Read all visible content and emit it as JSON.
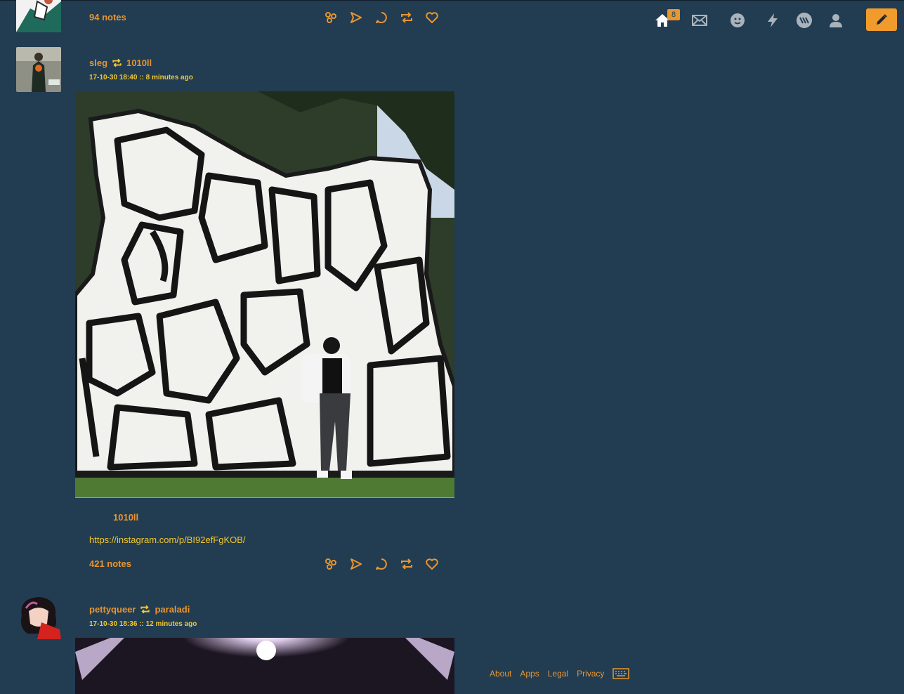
{
  "nav": {
    "home_badge": "8",
    "icons": [
      "home-icon",
      "mail-icon",
      "chat-icon",
      "lightning-icon",
      "explore-icon",
      "account-icon",
      "compose-icon"
    ]
  },
  "posts": [
    {
      "notes": "94 notes"
    },
    {
      "user": "sleg",
      "reblogged_from": "1010ll",
      "timestamp": "17-10-30 18:40 :: 8 minutes ago",
      "caption_user": "1010ll",
      "link": "https://instagram.com/p/BI92efFgKOB/",
      "notes": "421 notes"
    },
    {
      "user": "pettyqueer",
      "reblogged_from": "paraladi",
      "timestamp": "17-10-30 18:36 :: 12 minutes ago"
    }
  ],
  "footer": {
    "links": [
      "About",
      "Apps",
      "Legal",
      "Privacy"
    ]
  },
  "colors": {
    "background": "#223c52",
    "accent": "#e8962e",
    "meta": "#f2c82f"
  }
}
